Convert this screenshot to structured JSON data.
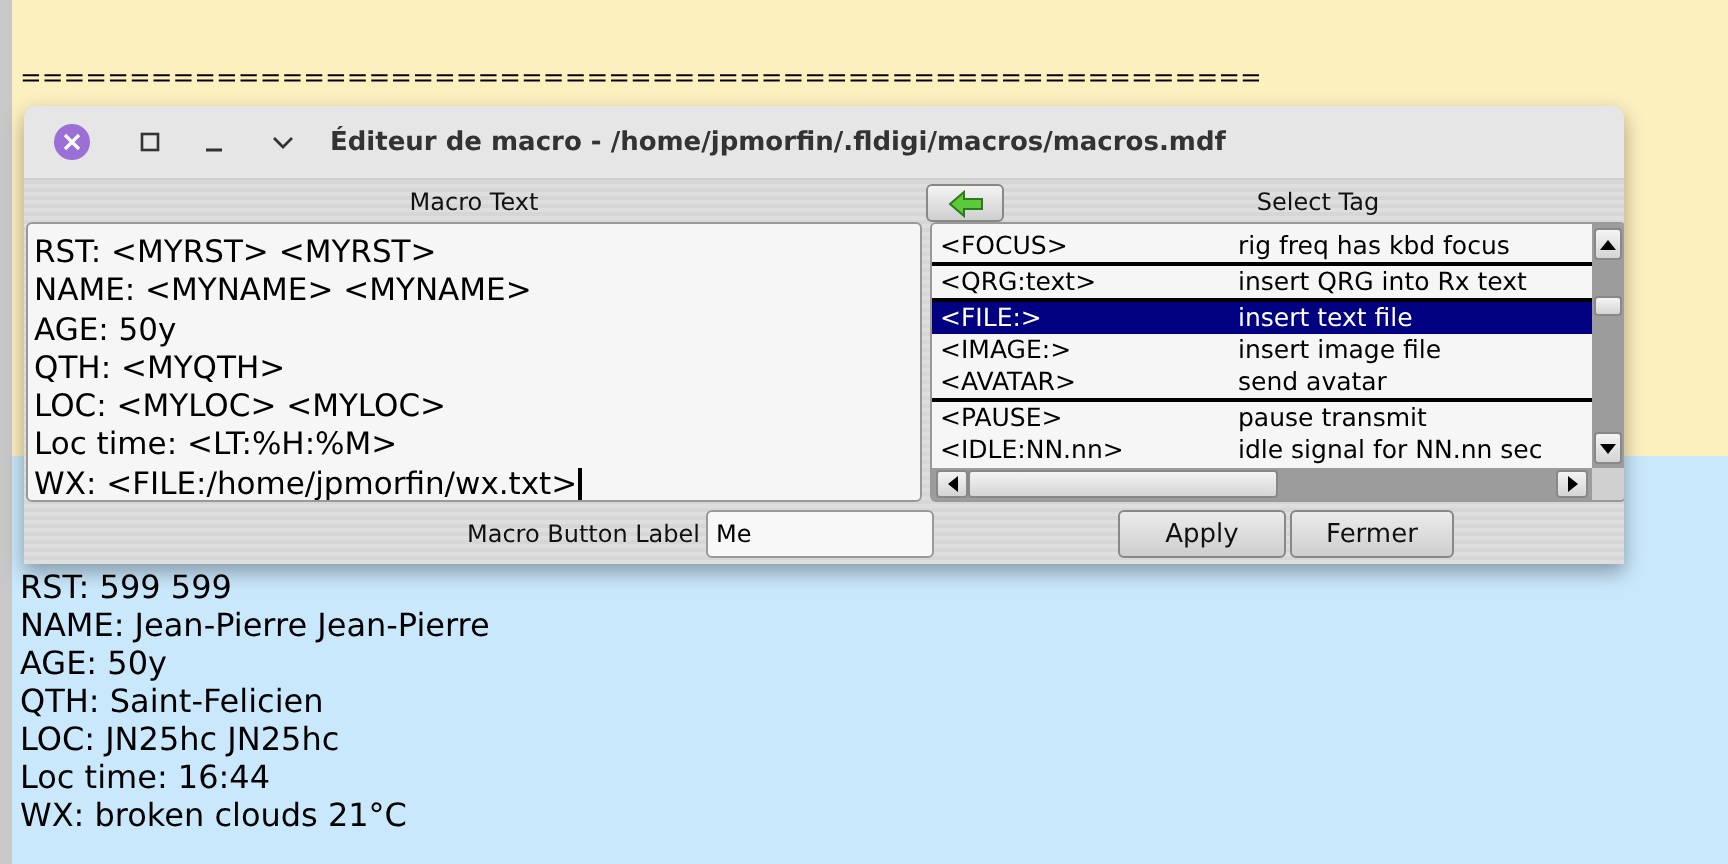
{
  "background": {
    "rule": "=========================================================",
    "lines": [
      "RST: 599 599",
      "NAME: Jean-Pierre Jean-Pierre",
      "AGE: 50y",
      "QTH: Saint-Felicien",
      "LOC: JN25hc JN25hc",
      "Loc time: 16:44",
      "WX: broken clouds 21°C"
    ]
  },
  "dialog": {
    "title": "Éditeur de macro - /home/jpmorfin/.fldigi/macros/macros.mdf",
    "macro_text": {
      "header": "Macro Text",
      "lines": [
        "RST: <MYRST> <MYRST>",
        "NAME: <MYNAME> <MYNAME>",
        "AGE: 50y",
        "QTH: <MYQTH>",
        "LOC: <MYLOC> <MYLOC>",
        "Loc time: <LT:%H:%M>",
        "WX: <FILE:/home/jpmorfin/wx.txt>"
      ]
    },
    "tag_panel": {
      "header": "Select Tag",
      "groups": [
        [
          {
            "tag": "<FOCUS>",
            "description": "rig freq has kbd focus",
            "selected": false
          }
        ],
        [
          {
            "tag": "<QRG:text>",
            "description": "insert QRG into Rx text",
            "selected": false
          }
        ],
        [
          {
            "tag": "<FILE:>",
            "description": "insert text file",
            "selected": true
          },
          {
            "tag": "<IMAGE:>",
            "description": "insert image file",
            "selected": false
          },
          {
            "tag": "<AVATAR>",
            "description": "send avatar",
            "selected": false
          }
        ],
        [
          {
            "tag": "<PAUSE>",
            "description": "pause transmit",
            "selected": false
          },
          {
            "tag": "<IDLE:NN.nn>",
            "description": "idle signal for NN.nn sec",
            "selected": false
          }
        ]
      ]
    },
    "button_label": {
      "label": "Macro Button Label",
      "value": "Me"
    },
    "buttons": [
      "Apply",
      "Fermer"
    ]
  }
}
